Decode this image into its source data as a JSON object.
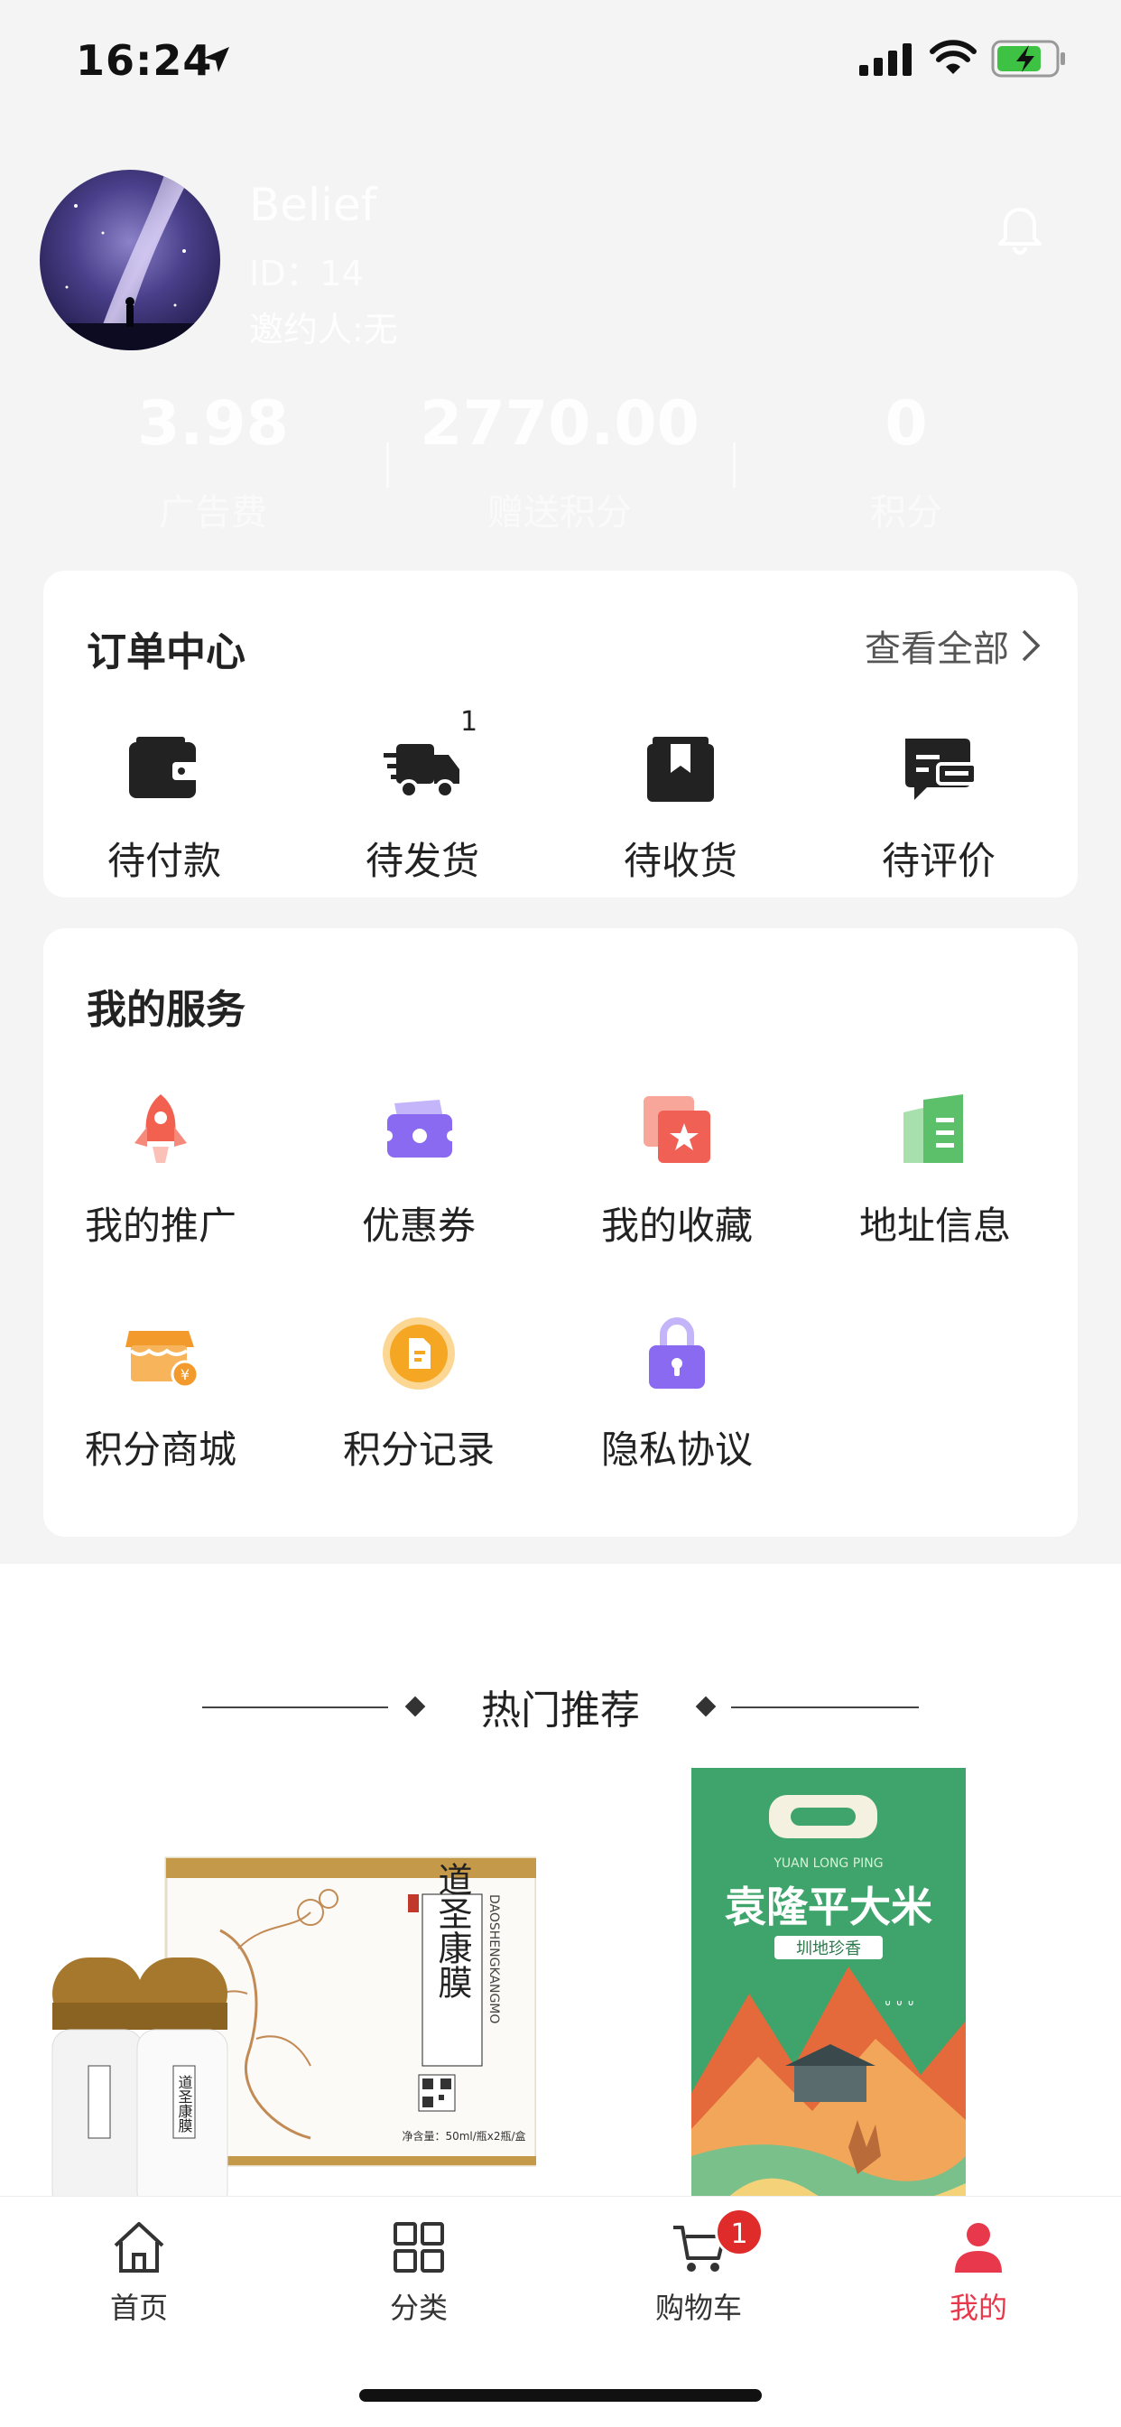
{
  "status_bar": {
    "time": "16:24"
  },
  "profile": {
    "name": "Belief",
    "id": "ID：14",
    "inviter": "邀约人:无"
  },
  "stats": [
    {
      "value": "3.98",
      "label": "广告费"
    },
    {
      "value": "2770.00",
      "label": "赠送积分"
    },
    {
      "value": "0",
      "label": "积分"
    }
  ],
  "orders": {
    "title": "订单中心",
    "view_all": "查看全部",
    "items": [
      {
        "label": "待付款",
        "icon": "wallet-icon"
      },
      {
        "label": "待发货",
        "icon": "delivery-truck-icon",
        "badge": "1"
      },
      {
        "label": "待收货",
        "icon": "package-box-icon"
      },
      {
        "label": "待评价",
        "icon": "comment-icon"
      }
    ]
  },
  "services": {
    "title": "我的服务",
    "items": [
      {
        "label": "我的推广",
        "icon": "rocket-icon",
        "color": "#f2604f"
      },
      {
        "label": "优惠券",
        "icon": "coupon-icon",
        "color": "#8a6af0"
      },
      {
        "label": "我的收藏",
        "icon": "favorite-star-icon",
        "color": "#f06055"
      },
      {
        "label": "地址信息",
        "icon": "address-document-icon",
        "color": "#5cc06a"
      },
      {
        "label": "积分商城",
        "icon": "points-shop-icon",
        "color": "#f39a2c"
      },
      {
        "label": "积分记录",
        "icon": "points-record-icon",
        "color": "#f5a623"
      },
      {
        "label": "隐私协议",
        "icon": "lock-icon",
        "color": "#8a6af0"
      }
    ]
  },
  "hot": {
    "title": "热门推荐"
  },
  "products": [
    {
      "box_title": "道圣康膜",
      "brand": "道圣康膜",
      "pinyin": "DAOSHENGKANGMO",
      "spec": "净含量：50ml/瓶x2瓶/盒"
    },
    {
      "title": "袁隆平大米",
      "subtitle": "YUAN LONG PING",
      "tag": "圳地珍香"
    }
  ],
  "tabbar": {
    "items": [
      {
        "label": "首页",
        "icon": "home-icon"
      },
      {
        "label": "分类",
        "icon": "category-grid-icon"
      },
      {
        "label": "购物车",
        "icon": "cart-icon",
        "badge": "1"
      },
      {
        "label": "我的",
        "icon": "user-icon",
        "active": true
      }
    ]
  },
  "colors": {
    "accent": "#e8384b",
    "cart_badge": "#e02b2b"
  }
}
